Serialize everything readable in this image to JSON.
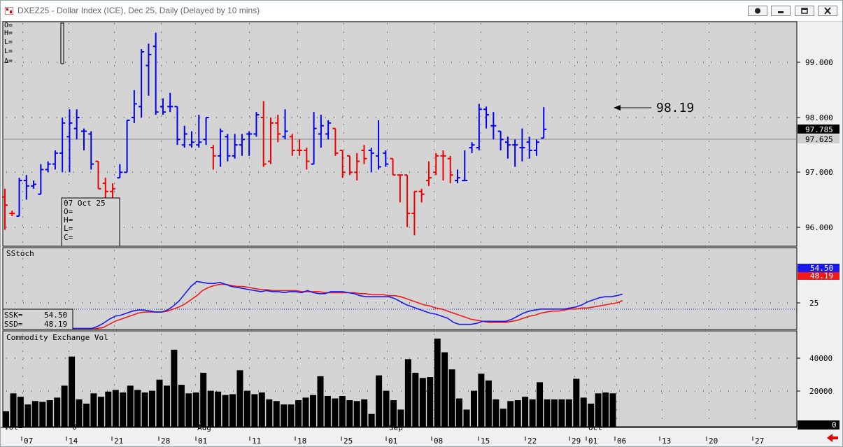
{
  "window": {
    "title": "DXEZ25 - Dollar Index (ICE), Dec 25, Daily (Delayed by 10 mins)"
  },
  "price_panel": {
    "top_readout": [
      "O=",
      "H=",
      "L=",
      "L=",
      "Δ="
    ],
    "hover_box": [
      "07 Oct 25",
      "O=",
      "H=",
      "L=",
      "C="
    ],
    "current_price_label": "97.785",
    "reference_line_label": "97.625",
    "callout_label": "98.19",
    "axis_ticks": [
      "99.000",
      "98.000",
      "97.000",
      "96.000"
    ]
  },
  "stoch_panel": {
    "title": "SStoch",
    "ssk_label": "SSK=",
    "ssk_value": "54.50",
    "ssd_label": "SSD=",
    "ssd_value": "48.19",
    "axis_tick": "25",
    "right_label_ssk": "54.50",
    "right_label_ssd": "48.19"
  },
  "volume_panel": {
    "title": "Commodity Exchange Vol",
    "vol_label": "Vol=",
    "vol_value": "0",
    "right_label": "0",
    "axis_ticks": [
      "40000",
      "20000"
    ]
  },
  "date_axis": {
    "month_labels": [
      "Aug",
      "Sep",
      "Oct"
    ],
    "day_labels": [
      "07",
      "14",
      "21",
      "28",
      "01",
      "11",
      "18",
      "25",
      "01",
      "08",
      "15",
      "22",
      "29",
      "01",
      "06",
      "13",
      "20",
      "27"
    ]
  },
  "colors": {
    "up_bar": "#0000ee",
    "down_bar": "#ee0000",
    "ssk_line": "#1a1aee",
    "ssd_line": "#ee1a1a",
    "volume_bar": "#000000",
    "panel_bg": "#d4d4d4"
  },
  "chart_data": [
    {
      "type": "ohlc",
      "title": "DXEZ25 - Dollar Index (ICE), Dec 25, Daily",
      "ylim": [
        95.65,
        99.75
      ],
      "bars": [
        {
          "o": 96.55,
          "h": 96.7,
          "l": 95.95,
          "c": 96.4,
          "dir": "down"
        },
        {
          "o": 96.25,
          "h": 96.3,
          "l": 96.2,
          "c": 96.25,
          "dir": "down"
        },
        {
          "o": 96.2,
          "h": 96.9,
          "l": 96.2,
          "c": 96.85,
          "dir": "up"
        },
        {
          "o": 96.85,
          "h": 96.95,
          "l": 96.5,
          "c": 96.75,
          "dir": "up"
        },
        {
          "o": 96.75,
          "h": 96.85,
          "l": 96.7,
          "c": 96.78,
          "dir": "up"
        },
        {
          "o": 96.6,
          "h": 97.15,
          "l": 96.6,
          "c": 97.05,
          "dir": "up"
        },
        {
          "o": 97.05,
          "h": 97.2,
          "l": 97.0,
          "c": 97.15,
          "dir": "up"
        },
        {
          "o": 97.15,
          "h": 97.4,
          "l": 97.05,
          "c": 97.35,
          "dir": "up"
        },
        {
          "o": 97.35,
          "h": 98.0,
          "l": 97.0,
          "c": 97.9,
          "dir": "up"
        },
        {
          "o": 97.65,
          "h": 98.15,
          "l": 97.0,
          "c": 97.9,
          "dir": "up"
        },
        {
          "o": 97.8,
          "h": 98.15,
          "l": 97.6,
          "c": 98.0,
          "dir": "up"
        },
        {
          "o": 97.75,
          "h": 97.8,
          "l": 97.4,
          "c": 97.75,
          "dir": "up"
        },
        {
          "o": 97.7,
          "h": 97.75,
          "l": 97.05,
          "c": 97.15,
          "dir": "up"
        },
        {
          "o": 97.2,
          "h": 97.2,
          "l": 96.7,
          "c": 96.7,
          "dir": "down"
        },
        {
          "o": 96.8,
          "h": 96.9,
          "l": 96.5,
          "c": 96.65,
          "dir": "down"
        },
        {
          "o": 96.65,
          "h": 96.8,
          "l": 96.5,
          "c": 96.7,
          "dir": "down"
        },
        {
          "o": 96.9,
          "h": 97.15,
          "l": 96.9,
          "c": 97.0,
          "dir": "up"
        },
        {
          "o": 97.0,
          "h": 97.95,
          "l": 97.0,
          "c": 97.95,
          "dir": "up"
        },
        {
          "o": 98.0,
          "h": 98.5,
          "l": 97.9,
          "c": 98.25,
          "dir": "up"
        },
        {
          "o": 98.2,
          "h": 99.25,
          "l": 98.0,
          "c": 99.2,
          "dir": "up"
        },
        {
          "o": 98.95,
          "h": 99.35,
          "l": 98.4,
          "c": 99.15,
          "dir": "up"
        },
        {
          "o": 99.3,
          "h": 99.55,
          "l": 98.05,
          "c": 98.1,
          "dir": "up"
        },
        {
          "o": 98.2,
          "h": 98.35,
          "l": 98.05,
          "c": 98.1,
          "dir": "up"
        },
        {
          "o": 98.2,
          "h": 98.45,
          "l": 98.1,
          "c": 98.2,
          "dir": "up"
        },
        {
          "o": 98.2,
          "h": 98.2,
          "l": 97.5,
          "c": 97.6,
          "dir": "up"
        },
        {
          "o": 97.5,
          "h": 97.85,
          "l": 97.45,
          "c": 97.7,
          "dir": "up"
        },
        {
          "o": 97.5,
          "h": 97.75,
          "l": 97.45,
          "c": 97.55,
          "dir": "up"
        },
        {
          "o": 97.5,
          "h": 98.05,
          "l": 97.45,
          "c": 97.55,
          "dir": "up"
        },
        {
          "o": 97.6,
          "h": 98.0,
          "l": 97.5,
          "c": 98.0,
          "dir": "up"
        },
        {
          "o": 97.45,
          "h": 97.5,
          "l": 97.05,
          "c": 97.3,
          "dir": "down"
        },
        {
          "o": 97.3,
          "h": 97.8,
          "l": 97.1,
          "c": 97.75,
          "dir": "up"
        },
        {
          "o": 97.65,
          "h": 97.7,
          "l": 97.2,
          "c": 97.3,
          "dir": "up"
        },
        {
          "o": 97.3,
          "h": 97.7,
          "l": 97.25,
          "c": 97.5,
          "dir": "up"
        },
        {
          "o": 97.5,
          "h": 97.7,
          "l": 97.3,
          "c": 97.6,
          "dir": "up"
        },
        {
          "o": 97.7,
          "h": 97.75,
          "l": 97.3,
          "c": 97.7,
          "dir": "up"
        },
        {
          "o": 97.7,
          "h": 98.1,
          "l": 97.65,
          "c": 98.05,
          "dir": "up"
        },
        {
          "o": 98.0,
          "h": 98.3,
          "l": 97.1,
          "c": 97.15,
          "dir": "down"
        },
        {
          "o": 97.2,
          "h": 98.0,
          "l": 97.15,
          "c": 97.9,
          "dir": "down"
        },
        {
          "o": 97.9,
          "h": 98.05,
          "l": 97.55,
          "c": 97.7,
          "dir": "down"
        },
        {
          "o": 97.65,
          "h": 98.15,
          "l": 97.6,
          "c": 97.75,
          "dir": "up"
        },
        {
          "o": 97.65,
          "h": 97.7,
          "l": 97.3,
          "c": 97.4,
          "dir": "down"
        },
        {
          "o": 97.4,
          "h": 97.6,
          "l": 97.3,
          "c": 97.4,
          "dir": "down"
        },
        {
          "o": 97.4,
          "h": 97.45,
          "l": 97.05,
          "c": 97.2,
          "dir": "down"
        },
        {
          "o": 97.15,
          "h": 98.1,
          "l": 97.15,
          "c": 97.8,
          "dir": "up"
        },
        {
          "o": 97.7,
          "h": 98.05,
          "l": 97.45,
          "c": 97.85,
          "dir": "up"
        },
        {
          "o": 97.7,
          "h": 97.95,
          "l": 97.6,
          "c": 97.9,
          "dir": "up"
        },
        {
          "o": 97.8,
          "h": 97.8,
          "l": 97.3,
          "c": 97.35,
          "dir": "down"
        },
        {
          "o": 97.4,
          "h": 97.4,
          "l": 96.9,
          "c": 97.0,
          "dir": "down"
        },
        {
          "o": 97.3,
          "h": 97.3,
          "l": 96.95,
          "c": 97.0,
          "dir": "down"
        },
        {
          "o": 97.0,
          "h": 97.35,
          "l": 96.85,
          "c": 97.2,
          "dir": "down"
        },
        {
          "o": 97.4,
          "h": 97.5,
          "l": 97.15,
          "c": 97.25,
          "dir": "down"
        },
        {
          "o": 97.4,
          "h": 97.45,
          "l": 97.0,
          "c": 97.35,
          "dir": "up"
        },
        {
          "o": 97.3,
          "h": 97.95,
          "l": 97.05,
          "c": 97.1,
          "dir": "up"
        },
        {
          "o": 97.35,
          "h": 97.4,
          "l": 97.1,
          "c": 97.15,
          "dir": "up"
        },
        {
          "o": 97.25,
          "h": 97.25,
          "l": 96.95,
          "c": 96.95,
          "dir": "down"
        },
        {
          "o": 96.95,
          "h": 96.95,
          "l": 96.45,
          "c": 96.95,
          "dir": "down"
        },
        {
          "o": 96.95,
          "h": 96.95,
          "l": 96.0,
          "c": 96.25,
          "dir": "down"
        },
        {
          "o": 96.25,
          "h": 96.65,
          "l": 95.85,
          "c": 96.65,
          "dir": "down"
        },
        {
          "o": 96.65,
          "h": 96.7,
          "l": 96.45,
          "c": 96.6,
          "dir": "down"
        },
        {
          "o": 96.85,
          "h": 97.2,
          "l": 96.75,
          "c": 96.9,
          "dir": "down"
        },
        {
          "o": 97.0,
          "h": 97.35,
          "l": 96.95,
          "c": 97.3,
          "dir": "down"
        },
        {
          "o": 97.3,
          "h": 97.4,
          "l": 96.85,
          "c": 97.3,
          "dir": "down"
        },
        {
          "o": 97.25,
          "h": 97.3,
          "l": 96.8,
          "c": 96.95,
          "dir": "down"
        },
        {
          "o": 96.85,
          "h": 97.05,
          "l": 96.8,
          "c": 96.9,
          "dir": "up"
        },
        {
          "o": 96.85,
          "h": 97.4,
          "l": 96.85,
          "c": 96.85,
          "dir": "up"
        },
        {
          "o": 97.45,
          "h": 97.55,
          "l": 97.35,
          "c": 97.5,
          "dir": "up"
        },
        {
          "o": 97.45,
          "h": 98.25,
          "l": 97.4,
          "c": 98.15,
          "dir": "up"
        },
        {
          "o": 98.15,
          "h": 98.2,
          "l": 97.8,
          "c": 98.05,
          "dir": "up"
        },
        {
          "o": 97.85,
          "h": 98.1,
          "l": 97.6,
          "c": 97.85,
          "dir": "up"
        },
        {
          "o": 97.75,
          "h": 97.75,
          "l": 97.4,
          "c": 97.6,
          "dir": "up"
        },
        {
          "o": 97.55,
          "h": 97.65,
          "l": 97.25,
          "c": 97.5,
          "dir": "up"
        },
        {
          "o": 97.5,
          "h": 97.6,
          "l": 97.1,
          "c": 97.5,
          "dir": "up"
        },
        {
          "o": 97.45,
          "h": 97.8,
          "l": 97.2,
          "c": 97.45,
          "dir": "up"
        },
        {
          "o": 97.55,
          "h": 97.65,
          "l": 97.25,
          "c": 97.4,
          "dir": "up"
        },
        {
          "o": 97.4,
          "h": 97.6,
          "l": 97.3,
          "c": 97.55,
          "dir": "up"
        },
        {
          "o": 97.625,
          "h": 98.19,
          "l": 97.625,
          "c": 97.785,
          "dir": "up"
        }
      ]
    },
    {
      "type": "line",
      "title": "SStoch",
      "ylim": [
        20,
        100
      ],
      "series": [
        {
          "name": "SSK",
          "values": [
            21,
            21,
            21,
            21,
            21,
            21,
            21,
            23,
            26,
            30,
            33,
            34,
            36,
            38,
            39,
            39,
            38,
            37,
            37,
            39,
            43,
            48,
            55,
            62,
            67,
            66,
            65,
            65,
            66,
            64,
            62,
            61,
            60,
            59,
            58,
            57,
            58,
            57,
            57,
            56,
            57,
            57,
            56,
            58,
            56,
            55,
            55,
            57,
            57,
            57,
            56,
            55,
            53,
            52,
            52,
            52,
            52,
            52,
            50,
            47,
            44,
            42,
            40,
            38,
            36,
            35,
            33,
            31,
            27,
            25,
            25,
            25,
            26,
            28,
            28,
            28,
            28,
            28,
            30,
            33,
            36,
            38,
            39,
            40,
            40,
            40,
            40,
            40,
            41,
            42,
            44,
            47,
            49,
            51,
            52,
            52,
            53,
            54.5
          ]
        },
        {
          "name": "SSD",
          "values": [
            21,
            21,
            21,
            21,
            21,
            21,
            21,
            21,
            22,
            25,
            28,
            30,
            32,
            34,
            36,
            37,
            37,
            37,
            37,
            38,
            40,
            42,
            45,
            49,
            53,
            58,
            61,
            63,
            64,
            64,
            63,
            62,
            62,
            61,
            60,
            59,
            59,
            58,
            58,
            58,
            58,
            58,
            57,
            57,
            57,
            57,
            56,
            56,
            56,
            56,
            56,
            56,
            55,
            55,
            54,
            54,
            54,
            53,
            53,
            52,
            50,
            48,
            46,
            44,
            43,
            41,
            40,
            38,
            36,
            34,
            32,
            30,
            29,
            28,
            27,
            27,
            27,
            27,
            28,
            29,
            31,
            33,
            34,
            36,
            37,
            38,
            38,
            39,
            40,
            40,
            41,
            41,
            42,
            43,
            44,
            45,
            46,
            48.19
          ]
        }
      ]
    },
    {
      "type": "bar",
      "title": "Commodity Exchange Vol",
      "ylim": [
        0,
        56000
      ],
      "values": [
        9000,
        19500,
        17500,
        13000,
        15000,
        14500,
        15500,
        17000,
        24000,
        41000,
        16000,
        13500,
        19500,
        17500,
        20500,
        21500,
        20000,
        24000,
        21500,
        20000,
        21000,
        27500,
        24000,
        45000,
        24500,
        19500,
        20000,
        31500,
        21000,
        20500,
        18500,
        19000,
        33000,
        21000,
        19000,
        20000,
        16000,
        15000,
        13000,
        13000,
        15500,
        17000,
        18500,
        29500,
        18000,
        16500,
        18000,
        15500,
        15000,
        16000,
        7500,
        30000,
        21000,
        15500,
        10000,
        39500,
        31500,
        28500,
        29000,
        51500,
        43500,
        33500,
        16500,
        10000,
        21000,
        31000,
        27000,
        16000,
        10500,
        15000,
        15500,
        17500,
        16000,
        26000,
        16000,
        16000,
        16000,
        16000,
        28000,
        17000,
        13500,
        19500,
        20000,
        19500
      ]
    }
  ]
}
